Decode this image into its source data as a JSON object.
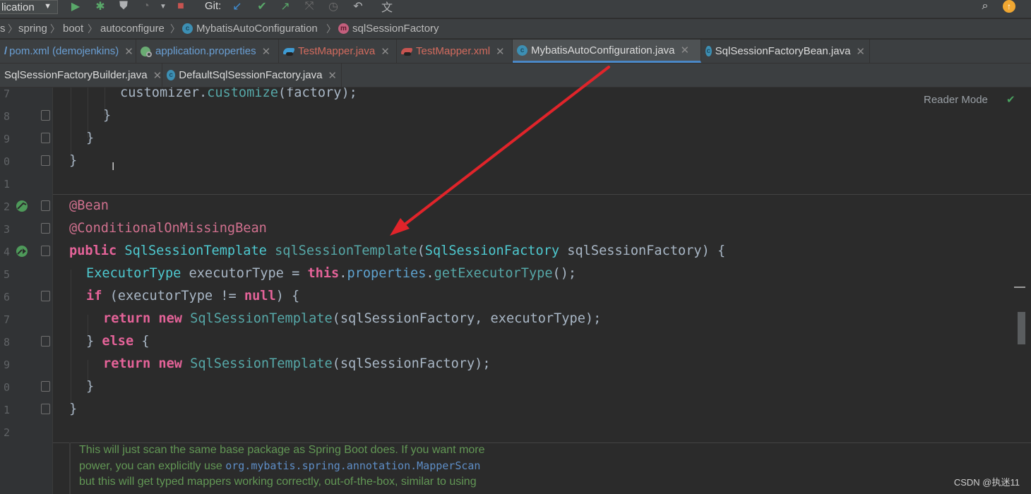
{
  "toolbar": {
    "run_config": "lication",
    "git_label": "Git:",
    "icons": [
      "run-icon",
      "debug-icon",
      "coverage-icon",
      "profile-icon",
      "stop-icon",
      "git-update-icon",
      "git-commit-icon",
      "git-push-icon",
      "git-merge-icon",
      "git-history-icon",
      "git-rollback-icon",
      "translate-icon",
      "search-icon",
      "update-icon"
    ]
  },
  "breadcrumb": {
    "items": [
      "s",
      "spring",
      "boot",
      "autoconfigure",
      "MybatisAutoConfiguration",
      "sqlSessionFactory"
    ]
  },
  "tabs_row1": [
    {
      "label": "pom.xml (demojenkins)",
      "color": "#6a9fd4"
    },
    {
      "label": "application.properties",
      "color": "#6a9fd4"
    },
    {
      "label": "TestMapper.java",
      "color": "#d26b5e"
    },
    {
      "label": "TestMapper.xml",
      "color": "#d26b5e"
    },
    {
      "label": "MybatisAutoConfiguration.java",
      "color": "#dcdcdc",
      "active": true
    },
    {
      "label": "SqlSessionFactoryBean.java",
      "color": "#dcdcdc"
    }
  ],
  "tabs_row2": [
    {
      "label": "SqlSessionFactoryBuilder.java",
      "color": "#dcdcdc"
    },
    {
      "label": "DefaultSqlSessionFactory.java",
      "color": "#dcdcdc"
    }
  ],
  "editor": {
    "reader_mode": "Reader Mode",
    "line_numbers": [
      "7",
      "8",
      "9",
      "0",
      "1",
      "2",
      "3",
      "4",
      "5",
      "6",
      "7",
      "8",
      "9",
      "0",
      "1",
      "2"
    ],
    "code": {
      "l0": "customizer.",
      "l0m": "customize",
      "l0b": "(factory);",
      "l1": "}",
      "l2": "}",
      "l3": "}",
      "l5": "@Bean",
      "l6": "@ConditionalOnMissingBean",
      "l7_kw": "public",
      "l7_type": "SqlSessionTemplate",
      "l7_method": "sqlSessionTemplate",
      "l7_open": "(",
      "l7_ptype": "SqlSessionFactory",
      "l7_rest": " sqlSessionFactory) {",
      "l8_type": "ExecutorType",
      "l8_a": " executorType = ",
      "l8_kw": "this",
      "l8_dot": ".",
      "l8_field": "properties",
      "l8_method": "getExecutorType",
      "l8_end": "();",
      "l9_kw": "if",
      "l9_a": " (executorType != ",
      "l9_null": "null",
      "l9_end": ") {",
      "l10_kw": "return",
      "l10_new": "new",
      "l10_type": "SqlSessionTemplate",
      "l10_rest": "(sqlSessionFactory, executorType);",
      "l11_a": "} ",
      "l11_kw": "else",
      "l11_b": " {",
      "l12_kw": "return",
      "l12_new": "new",
      "l12_type": "SqlSessionTemplate",
      "l12_rest": "(sqlSessionFactory);",
      "l13": "}",
      "l14": "}"
    },
    "doc_line1": "This will just scan the same base package as Spring Boot does. If you want more",
    "doc_line2_a": "power, you can explicitly use ",
    "doc_line2_code": "org.mybatis.spring.annotation.MapperScan",
    "doc_line3": "but this will get typed mappers working correctly, out-of-the-box, similar to using"
  },
  "watermark": "CSDN @执迷11",
  "annotation_arrow_color": "#e0242a"
}
